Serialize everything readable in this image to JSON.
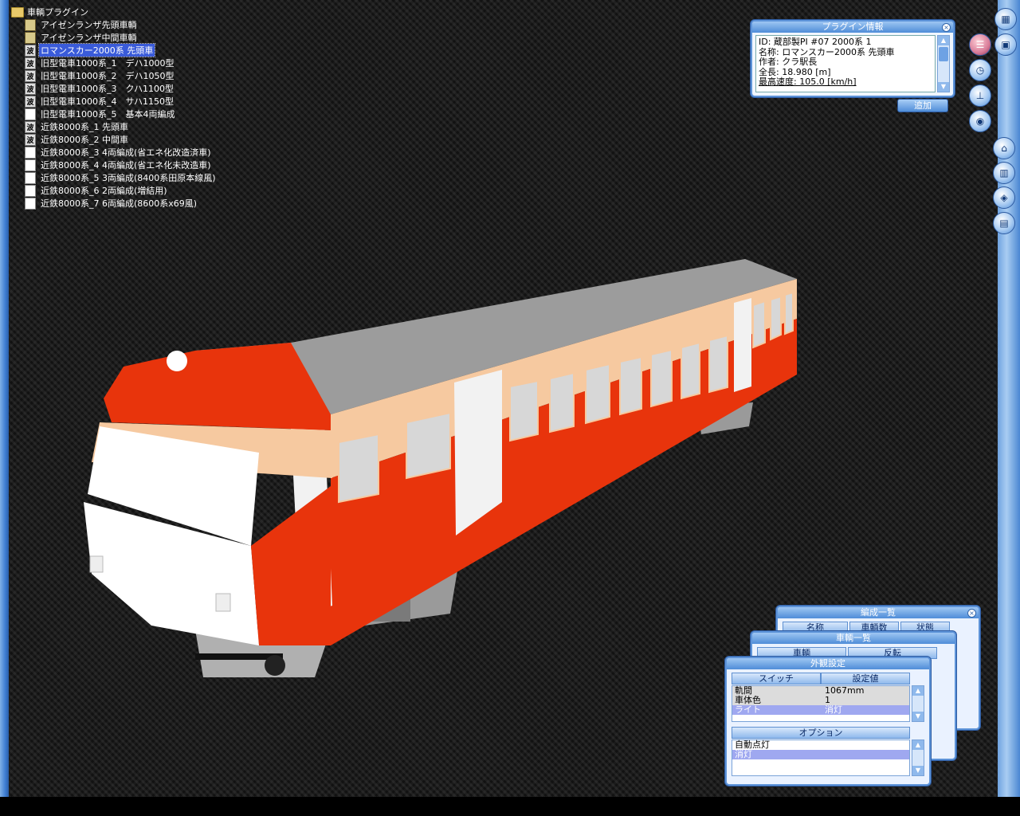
{
  "tree": {
    "root_label": "車輌プラグイン",
    "items": [
      {
        "icon": "book",
        "label": "アイゼンランザ先頭車輌"
      },
      {
        "icon": "book",
        "label": "アイゼンランザ中間車輌"
      },
      {
        "icon": "plugin",
        "label": "ロマンスカー2000系 先頭車",
        "selected": true
      },
      {
        "icon": "plugin",
        "label": "旧型電車1000系_1　デハ1000型"
      },
      {
        "icon": "plugin",
        "label": "旧型電車1000系_2　デハ1050型"
      },
      {
        "icon": "plugin",
        "label": "旧型電車1000系_3　クハ1100型"
      },
      {
        "icon": "plugin",
        "label": "旧型電車1000系_4　サハ1150型"
      },
      {
        "icon": "doc",
        "label": "旧型電車1000系_5　基本4両編成"
      },
      {
        "icon": "plugin",
        "label": "近鉄8000系_1 先頭車"
      },
      {
        "icon": "plugin",
        "label": "近鉄8000系_2 中間車"
      },
      {
        "icon": "doc",
        "label": "近鉄8000系_3 4両編成(省エネ化改造済車)"
      },
      {
        "icon": "doc",
        "label": "近鉄8000系_4 4両編成(省エネ化未改造車)"
      },
      {
        "icon": "doc",
        "label": "近鉄8000系_5 3両編成(8400系田原本線風)"
      },
      {
        "icon": "doc",
        "label": "近鉄8000系_6 2両編成(増結用)"
      },
      {
        "icon": "doc",
        "label": "近鉄8000系_7 6両編成(8600系x69風)"
      }
    ]
  },
  "plugin_info": {
    "title": "プラグイン情報",
    "lines": [
      "ID: 蔵部製PI #07 2000系 1",
      "名称: ロマンスカー2000系 先頭車",
      "作者: クラ駅長",
      "全長: 18.980 [m]",
      "最高速度: 105.0 [km/h]"
    ],
    "add_button": "追加"
  },
  "toolbar": {
    "icons": [
      "grid-icon",
      "track-icon",
      "car-icon",
      "clock-icon",
      "pantograph-icon",
      "eye-icon",
      "platform-icon",
      "building-icon",
      "layers-icon",
      "computer-icon"
    ]
  },
  "formation_list": {
    "title": "編成一覧",
    "columns": [
      "名称",
      "車輌数",
      "状態"
    ]
  },
  "vehicle_list": {
    "title": "車輌一覧",
    "columns": [
      "車輌",
      "反転"
    ]
  },
  "appearance": {
    "title": "外観設定",
    "columns": [
      "スイッチ",
      "設定値"
    ],
    "rows": [
      {
        "key": "軌間",
        "value": "1067mm"
      },
      {
        "key": "車体色",
        "value": "1"
      },
      {
        "key": "ライト",
        "value": "消灯"
      }
    ],
    "option_header": "オプション",
    "options": [
      "自動点灯",
      "消灯"
    ]
  },
  "colors": {
    "accent": "#4f8dd8",
    "train_red": "#e8340c",
    "train_cream": "#f6c9a0",
    "selection": "#3a5bd9"
  }
}
